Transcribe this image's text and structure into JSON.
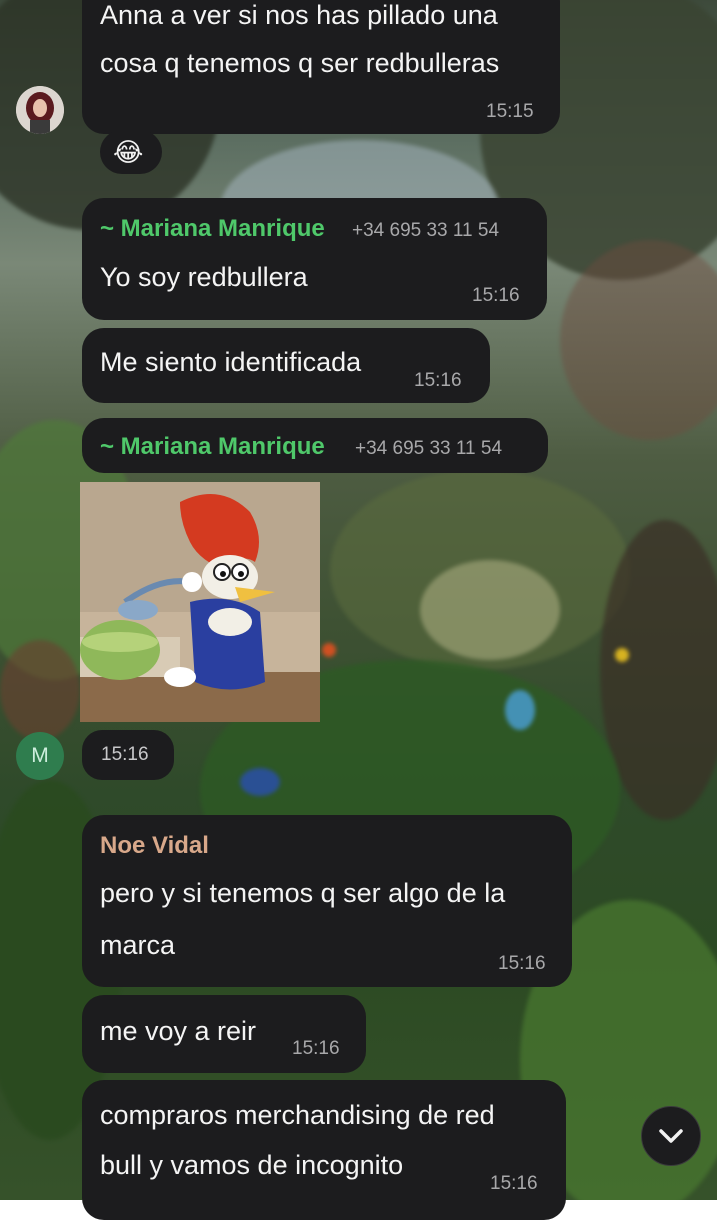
{
  "messages": {
    "m1": {
      "lines": [
        "Anna a ver si nos has pillado una",
        "cosa q tenemos q ser redbulleras"
      ],
      "time": "15:15"
    },
    "m2": {
      "sender": "~ Mariana Manrique",
      "phone": "+34 695 33 11 54",
      "text": "Yo soy redbullera",
      "time": "15:16"
    },
    "m3": {
      "text": "Me siento identificada",
      "time": "15:16"
    },
    "m4": {
      "sender": "~ Mariana Manrique",
      "phone": "+34 695 33 11 54",
      "time": "15:16"
    },
    "m5": {
      "sender": "Noe Vidal",
      "lines": [
        "pero y si tenemos q ser algo de la",
        "marca"
      ],
      "time": "15:16"
    },
    "m6": {
      "text": "me voy a reir",
      "time": "15:16"
    },
    "m7": {
      "lines": [
        "compraros merchandising de red",
        "bull y vamos de incognito"
      ],
      "time": "15:16"
    }
  },
  "reaction_emoji": "😂",
  "avatar_m_letter": "M",
  "colors": {
    "bubble": "#1c1c1e",
    "mariana_green": "#4fc86a",
    "noe_tan": "#d8a88a",
    "avatar_m_bg": "#2f7d4e"
  },
  "icons": {
    "scroll_down": "chevron-down-icon"
  }
}
